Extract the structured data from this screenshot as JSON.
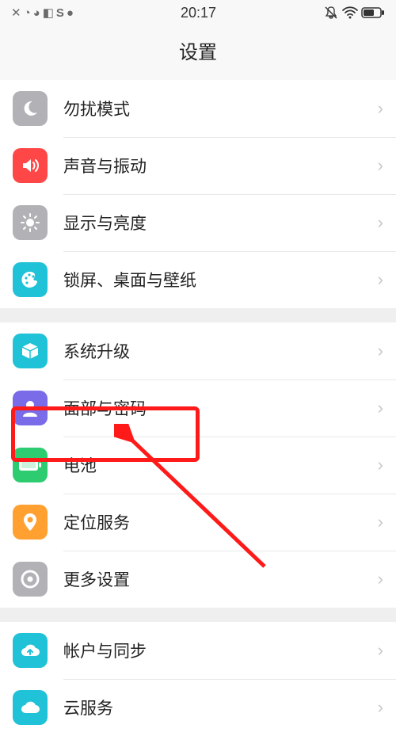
{
  "status_bar": {
    "time": "20:17"
  },
  "header": {
    "title": "设置"
  },
  "groups": [
    {
      "items": [
        {
          "id": "dnd",
          "label": "勿扰模式",
          "icon": "moon",
          "color": "#b1b1b6"
        },
        {
          "id": "sound",
          "label": "声音与振动",
          "icon": "speaker",
          "color": "#ff4747"
        },
        {
          "id": "display",
          "label": "显示与亮度",
          "icon": "brightness",
          "color": "#b1b1b6"
        },
        {
          "id": "lock",
          "label": "锁屏、桌面与壁纸",
          "icon": "palette",
          "color": "#1fc2d6"
        }
      ]
    },
    {
      "items": [
        {
          "id": "upgrade",
          "label": "系统升级",
          "icon": "cube",
          "color": "#1fc2d6"
        },
        {
          "id": "face",
          "label": "面部与密码",
          "icon": "person",
          "color": "#7a6be8"
        },
        {
          "id": "battery",
          "label": "电池",
          "icon": "battery",
          "color": "#2ecc71",
          "highlighted": true
        },
        {
          "id": "location",
          "label": "定位服务",
          "icon": "pin",
          "color": "#ffa030"
        },
        {
          "id": "more",
          "label": "更多设置",
          "icon": "gear",
          "color": "#b1b1b6"
        }
      ]
    },
    {
      "items": [
        {
          "id": "account",
          "label": "帐户与同步",
          "icon": "cloud-sync",
          "color": "#1fc2d6"
        },
        {
          "id": "cloud",
          "label": "云服务",
          "icon": "cloud",
          "color": "#1fc2d6"
        }
      ]
    }
  ],
  "annotation": {
    "highlight_target": "battery",
    "highlight_color": "#ff1a1a"
  }
}
